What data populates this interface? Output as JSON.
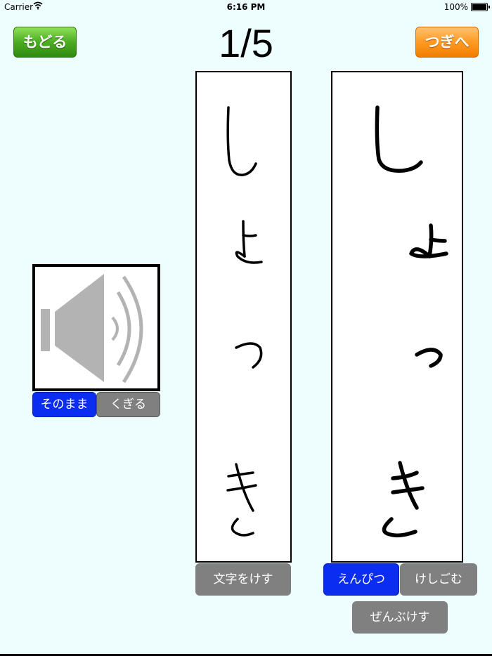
{
  "status_bar": {
    "carrier": "Carrier",
    "time": "6:16 PM",
    "battery": "100%"
  },
  "nav": {
    "back_label": "もどる",
    "next_label": "つぎへ",
    "counter": "1/5"
  },
  "audio": {
    "icon": "speaker-icon",
    "mode_as_is": "そのまま",
    "mode_split": "くぎる",
    "selected_mode": "そのまま"
  },
  "writing": {
    "model_text": "しょっき",
    "user_text": "しょっき",
    "clear_text_label": "文字をけす",
    "pencil_label": "えんぴつ",
    "eraser_label": "けしごむ",
    "clear_all_label": "ぜんぶけす",
    "selected_tool": "えんぴつ"
  },
  "colors": {
    "background": "#eefefe",
    "selected": "#0a2df0",
    "unselected": "#808080",
    "back_green": "#4cad22",
    "next_orange": "#ff9a22"
  }
}
